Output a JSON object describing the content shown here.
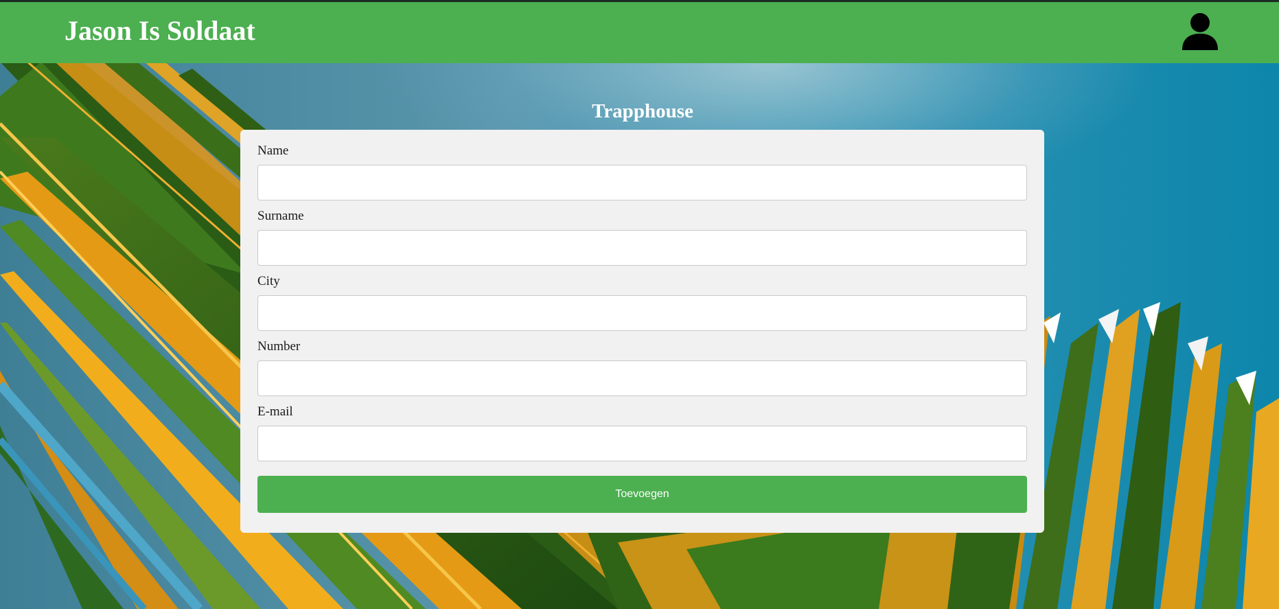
{
  "header": {
    "brand": "Jason Is Soldaat",
    "user_icon": "user-icon",
    "bar_color": "#4caf50"
  },
  "main": {
    "heading": "Trapphouse"
  },
  "form": {
    "fields": [
      {
        "label": "Name",
        "value": "",
        "placeholder": ""
      },
      {
        "label": "Surname",
        "value": "",
        "placeholder": ""
      },
      {
        "label": "City",
        "value": "",
        "placeholder": ""
      },
      {
        "label": "Number",
        "value": "",
        "placeholder": ""
      },
      {
        "label": "E-mail",
        "value": "",
        "placeholder": ""
      }
    ],
    "submit_label": "Toevoegen",
    "card_color": "#f1f1f1"
  },
  "background": {
    "description_icon": "palm-leaf-photo",
    "sky_color": "#0f7fa3"
  }
}
